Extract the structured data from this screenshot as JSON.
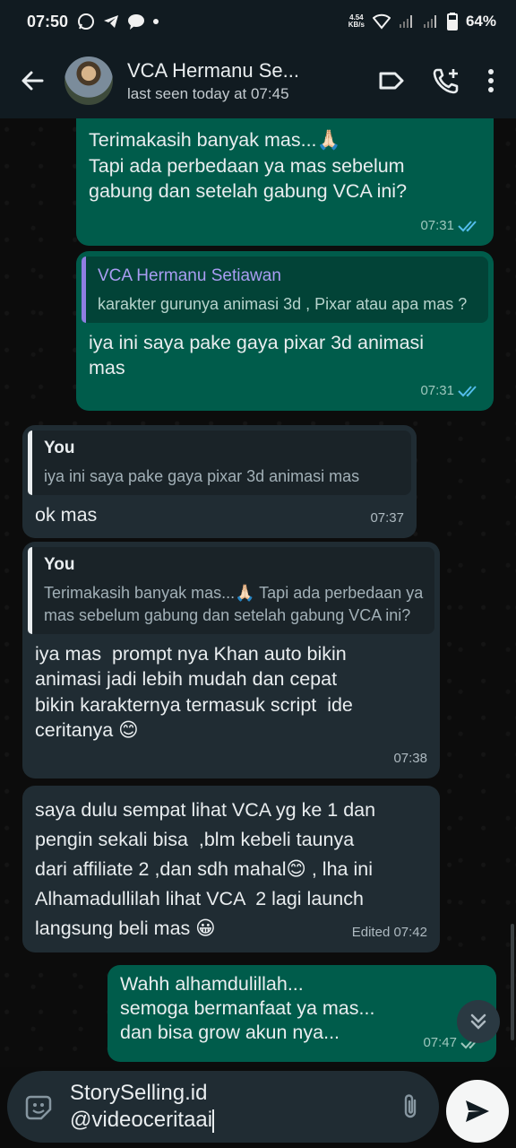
{
  "status_bar": {
    "time": "07:50",
    "net_speed_value": "4.54",
    "net_speed_unit": "KB/s",
    "battery": "64%"
  },
  "header": {
    "contact_name": "VCA Hermanu Se...",
    "last_seen": "last seen today at 07:45"
  },
  "messages": {
    "m1": {
      "lines": [
        "Terimakasih banyak mas...🙏🏻",
        "Tapi ada perbedaan ya mas sebelum",
        "gabung dan setelah gabung VCA ini?"
      ],
      "time": "07:31"
    },
    "m2": {
      "quote_name": "VCA Hermanu Setiawan",
      "quote_text": "karakter gurunya animasi 3d , Pixar atau apa mas ?",
      "lines": [
        "iya ini saya pake gaya pixar 3d animasi",
        "mas"
      ],
      "time": "07:31"
    },
    "m3": {
      "quote_name": "You",
      "quote_text": "iya ini saya pake gaya pixar 3d animasi mas",
      "lines": [
        "ok mas"
      ],
      "time": "07:37"
    },
    "m4": {
      "quote_name": "You",
      "quote_text": "Terimakasih banyak mas...🙏🏻 Tapi ada perbedaan ya mas sebelum gabung dan setelah gabung VCA ini?",
      "lines": [
        "iya mas  prompt nya Khan auto bikin",
        "animasi jadi lebih mudah dan cepat",
        "bikin karakternya termasuk script  ide",
        "ceritanya 😊"
      ],
      "time": "07:38"
    },
    "m5": {
      "lines": [
        "saya dulu sempat lihat VCA yg ke 1 dan",
        "pengin sekali bisa  ,blm kebeli taunya",
        "dari affiliate 2 ,dan sdh mahal😊 , lha ini",
        "Alhamadullilah lihat VCA  2 lagi launch",
        "langsung beli mas 😀"
      ],
      "time": "Edited 07:42"
    },
    "m6": {
      "lines": [
        "Wahh alhamdulillah...",
        "semoga bermanfaat ya mas...",
        "dan bisa grow akun nya..."
      ],
      "time": "07:47"
    }
  },
  "input": {
    "lines": [
      "StorySelling.id",
      "@videoceritaai"
    ]
  },
  "icons": {
    "back": "arrow-left-icon",
    "label": "label-icon",
    "call": "add-call-icon",
    "menu": "more-vertical-icon",
    "emoji": "emoji-icon",
    "attach": "paperclip-icon",
    "send": "send-icon",
    "scroll": "double-chevron-down-icon"
  },
  "colors": {
    "outgoing_bubble": "#005c4b",
    "incoming_bubble": "#202c33",
    "read_tick": "#53bdeb"
  }
}
